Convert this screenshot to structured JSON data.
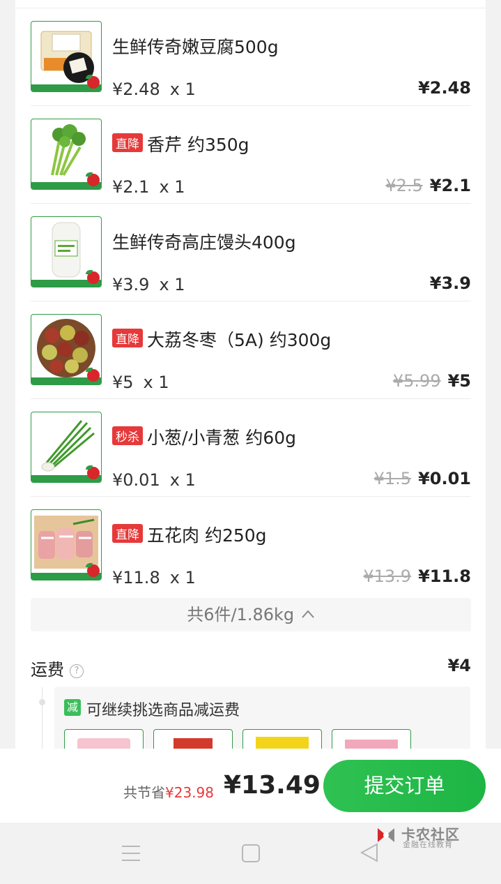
{
  "items": [
    {
      "name": "生鲜传奇嫩豆腐500g",
      "tag": "",
      "unit_price": "¥2.48",
      "qty": "x  1",
      "original": "",
      "price": "¥2.48"
    },
    {
      "name": "香芹 约350g",
      "tag": "直降",
      "unit_price": "¥2.1",
      "qty": "x  1",
      "original": "¥2.5",
      "price": "¥2.1"
    },
    {
      "name": "生鲜传奇高庄馒头400g",
      "tag": "",
      "unit_price": "¥3.9",
      "qty": "x  1",
      "original": "",
      "price": "¥3.9"
    },
    {
      "name": "大荔冬枣（5A) 约300g",
      "tag": "直降",
      "unit_price": "¥5",
      "qty": "x  1",
      "original": "¥5.99",
      "price": "¥5"
    },
    {
      "name": "小葱/小青葱 约60g",
      "tag": "秒杀",
      "unit_price": "¥0.01",
      "qty": "x  1",
      "original": "¥1.5",
      "price": "¥0.01"
    },
    {
      "name": "五花肉 约250g",
      "tag": "直降",
      "unit_price": "¥11.8",
      "qty": "x  1",
      "original": "¥13.9",
      "price": "¥11.8"
    }
  ],
  "summary": {
    "text": "共6件/1.86kg",
    "icon": "chevron-up-icon"
  },
  "shipping": {
    "label": "运费",
    "price": "¥4",
    "help_icon": "question-circle-icon"
  },
  "promo": {
    "badge": "减",
    "text": "可继续挑选商品减运费"
  },
  "footer": {
    "savings_label": "共节省",
    "savings_amount": "¥23.98",
    "total": "¥13.49",
    "submit_label": "提交订单"
  },
  "watermark": {
    "title": "卡农社区",
    "subtitle": "金融在线教育"
  },
  "colors": {
    "accent": "#1db545",
    "tag": "#e6393a",
    "brand_border": "#2e9b46"
  }
}
